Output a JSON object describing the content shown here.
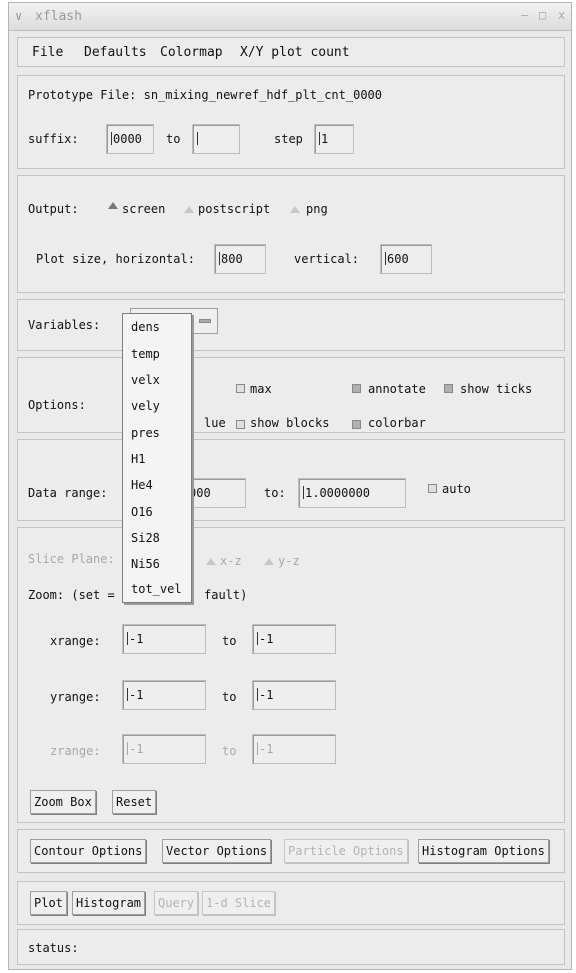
{
  "window": {
    "title": "xflash",
    "controls": [
      "–",
      "□",
      "x"
    ]
  },
  "menu": [
    "File",
    "Defaults",
    "Colormap",
    "X/Y plot count"
  ],
  "file_panel": {
    "prototype_label": "Prototype File: sn_mixing_newref_hdf_plt_cnt_0000",
    "suffix_label": "suffix:",
    "suffix_value": "0000",
    "to_label": "to",
    "to_value": "",
    "step_label": "step",
    "step_value": "1"
  },
  "output_panel": {
    "output_label": "Output:",
    "options": [
      {
        "label": "screen",
        "selected": true
      },
      {
        "label": "postscript",
        "selected": false
      },
      {
        "label": "png",
        "selected": false
      }
    ],
    "hsize_label": "Plot size, horizontal:",
    "hsize_value": "800",
    "vsize_label": "vertical:",
    "vsize_value": "600"
  },
  "variables_panel": {
    "label": "Variables:",
    "selected": "dens",
    "options": [
      "dens",
      "temp",
      "velx",
      "vely",
      "pres",
      "H1",
      "He4",
      "O16",
      "Si28",
      "Ni56",
      "tot_vel"
    ]
  },
  "options_panel": {
    "label": "Options:",
    "max": "max",
    "annotate": "annotate",
    "show_ticks": "show ticks",
    "lue_fragment": "lue",
    "show_blocks": "show blocks",
    "colorbar": "colorbar"
  },
  "range_panel": {
    "label": "Data range:",
    "from_value": "000",
    "to_label": "to:",
    "to_value": "1.0000000",
    "auto_label": "auto"
  },
  "zoom_panel": {
    "slice_label": "Slice Plane:",
    "plane_xz": "x-z",
    "plane_yz": "y-z",
    "zoom_label_left": "Zoom: (set =",
    "zoom_label_right": "fault)",
    "xrange_label": "xrange:",
    "yrange_label": "yrange:",
    "zrange_label": "zrange:",
    "range_value": "-1",
    "to_label": "to",
    "zoom_box": "Zoom Box",
    "reset": "Reset"
  },
  "option_buttons": [
    "Contour Options",
    "Vector Options",
    "Particle Options",
    "Histogram Options"
  ],
  "action_buttons": [
    "Plot",
    "Histogram",
    "Query",
    "1-d Slice"
  ],
  "status_label": "status:"
}
